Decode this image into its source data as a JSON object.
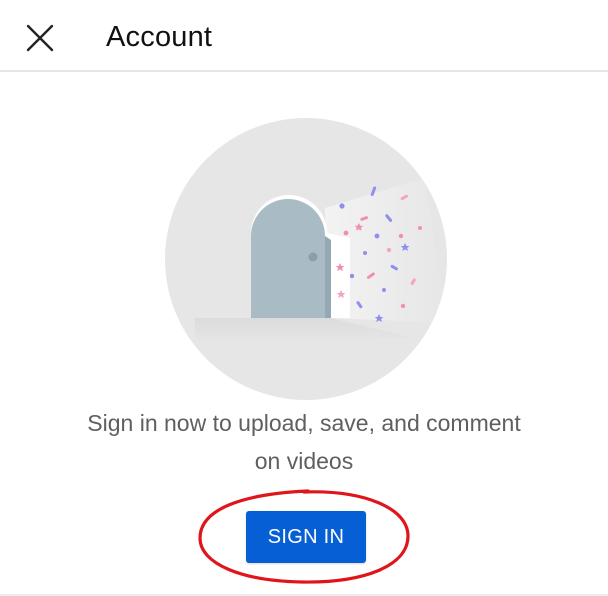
{
  "header": {
    "title": "Account",
    "close_icon": "close-icon"
  },
  "illustration": {
    "icon": "door-confetti-illustration",
    "colors": {
      "circle": "#e6e6e6",
      "door": "#a9bcc6",
      "confetti_blue": "#8f8ff0",
      "confetti_pink": "#f08fb0"
    }
  },
  "message": {
    "line1": "Sign in now to upload, save, and comment",
    "line2": "on videos"
  },
  "signin": {
    "label": "SIGN IN",
    "color": "#065fd4"
  },
  "annotation": {
    "color": "#e0151b"
  }
}
